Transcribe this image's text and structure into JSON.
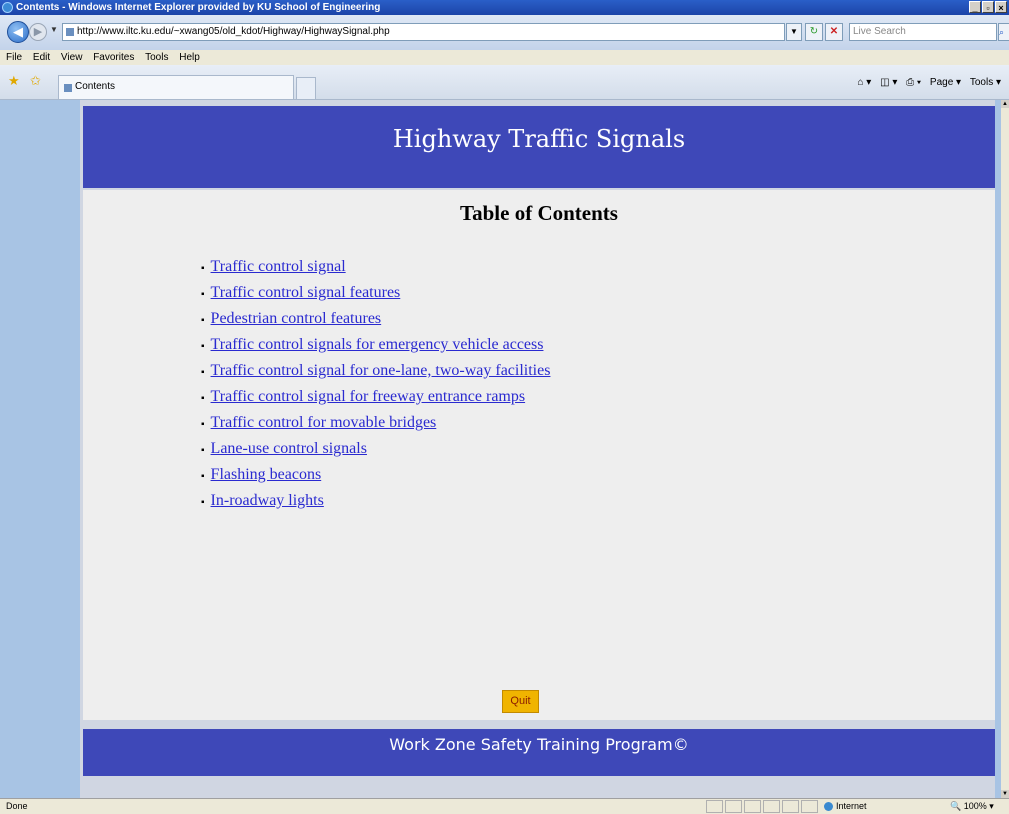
{
  "window": {
    "title": "Contents - Windows Internet Explorer provided by KU School of Engineering",
    "controls": [
      "_",
      "▫",
      "×"
    ]
  },
  "address_bar": {
    "url": "http://www.iltc.ku.edu/~xwang05/old_kdot/Highway/HighwaySignal.php",
    "search_placeholder": "Live Search"
  },
  "menu": {
    "items": [
      "File",
      "Edit",
      "View",
      "Favorites",
      "Tools",
      "Help"
    ]
  },
  "tabs": {
    "active_tab_label": "Contents",
    "command_bar": [
      "Page ▾",
      "Tools ▾"
    ]
  },
  "page": {
    "header_title": "Highway Traffic Signals",
    "toc_title": "Table of Contents",
    "toc_links": [
      "Traffic control signal",
      "Traffic control signal features",
      "Pedestrian control features",
      "Traffic control signals for emergency vehicle access",
      "Traffic control signal for one-lane, two-way facilities",
      "Traffic control signal for freeway entrance ramps",
      "Traffic control for movable bridges",
      "Lane-use control signals",
      "Flashing beacons",
      "In-roadway lights"
    ],
    "quit_label": "Quit",
    "footer_text": "Work Zone Safety Training Program©"
  },
  "status_bar": {
    "status": "Done",
    "zone": "Internet",
    "zoom": "100%"
  },
  "colors": {
    "band": "#3e48b8",
    "link": "#2a2ad0",
    "quit_button": "#f0b400",
    "sidebar": "#a8c4e4"
  }
}
